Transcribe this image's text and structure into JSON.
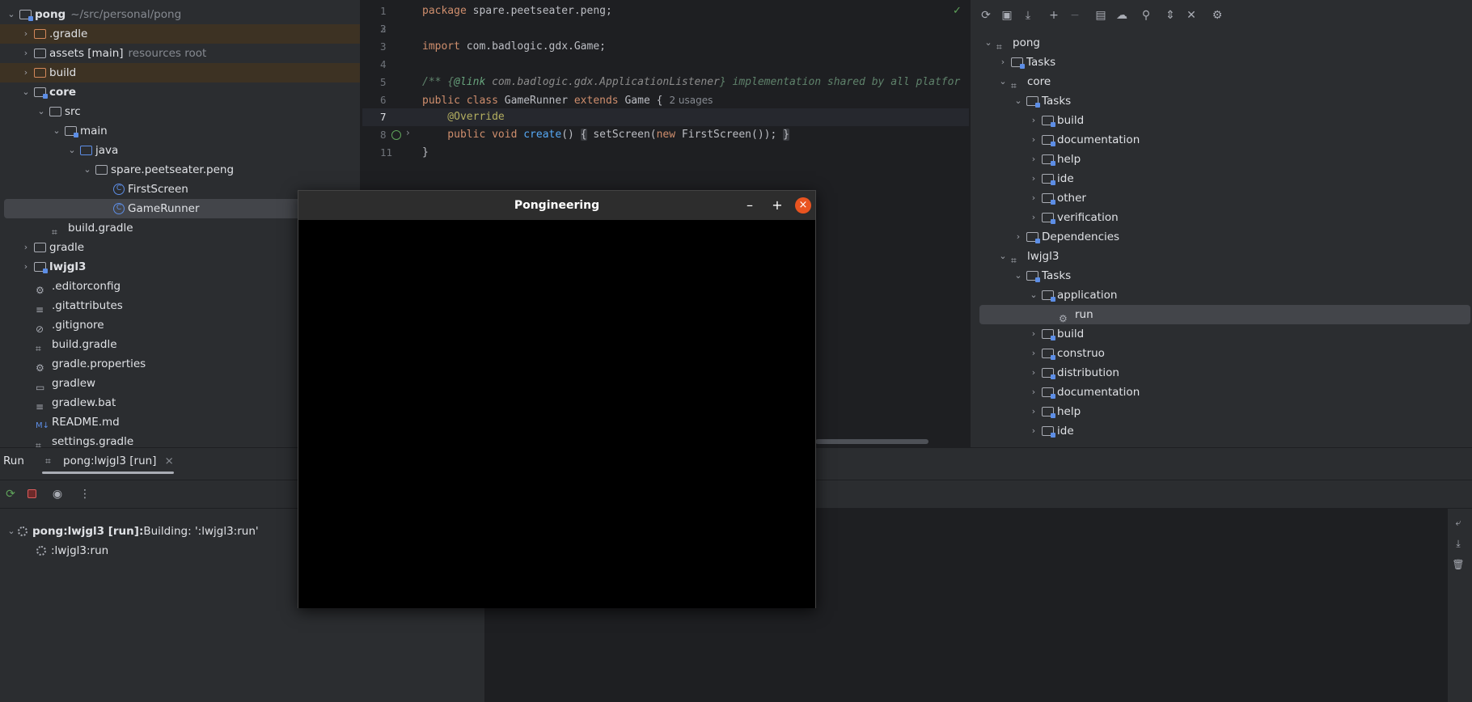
{
  "project": {
    "root_name": "pong",
    "root_path": "~/src/personal/pong",
    "items": [
      {
        "label": ".gradle"
      },
      {
        "label": "assets [main]",
        "suffix": "resources root"
      },
      {
        "label": "build"
      },
      {
        "label": "core"
      },
      {
        "label": "src"
      },
      {
        "label": "main"
      },
      {
        "label": "java"
      },
      {
        "label": "spare.peetseater.peng"
      },
      {
        "label": "FirstScreen"
      },
      {
        "label": "GameRunner"
      },
      {
        "label": "build.gradle"
      },
      {
        "label": "gradle"
      },
      {
        "label": "lwjgl3"
      },
      {
        "label": ".editorconfig"
      },
      {
        "label": ".gitattributes"
      },
      {
        "label": ".gitignore"
      },
      {
        "label": "build.gradle"
      },
      {
        "label": "gradle.properties"
      },
      {
        "label": "gradlew"
      },
      {
        "label": "gradlew.bat"
      },
      {
        "label": "README.md"
      },
      {
        "label": "settings.gradle"
      }
    ]
  },
  "editor": {
    "line_numbers": [
      "1",
      "3",
      "4",
      "5",
      "6",
      "7",
      "8",
      "11"
    ],
    "lines": {
      "l1_kw": "package",
      "l1_rest": " spare.peetseater.peng;",
      "l3_kw": "import",
      "l3_rest": " com.badlogic.gdx.Game;",
      "l5_comment_a": "/** {",
      "l5_tag": "@link",
      "l5_ref": " com.badlogic.gdx.ApplicationListener",
      "l5_comment_b": "} implementation shared by all platfor",
      "l6_kw1": "public class",
      "l6_name": " GameRunner ",
      "l6_kw2": "extends",
      "l6_rest": " Game {",
      "l6_hint": "2 usages",
      "l7_ann": "    @Override",
      "l8_kw": "    public void",
      "l8_fn": " create",
      "l8_a": "() ",
      "l8_b": "{",
      "l8_c": " setScreen(",
      "l8_kw2": "new",
      "l8_d": " FirstScreen()); ",
      "l8_e": "}",
      "l11": "}"
    }
  },
  "gradle": {
    "items": [
      {
        "label": "pong"
      },
      {
        "label": "Tasks"
      },
      {
        "label": "core"
      },
      {
        "label": "Tasks"
      },
      {
        "label": "build"
      },
      {
        "label": "documentation"
      },
      {
        "label": "help"
      },
      {
        "label": "ide"
      },
      {
        "label": "other"
      },
      {
        "label": "verification"
      },
      {
        "label": "Dependencies"
      },
      {
        "label": "lwjgl3"
      },
      {
        "label": "Tasks"
      },
      {
        "label": "application"
      },
      {
        "label": "run"
      },
      {
        "label": "build"
      },
      {
        "label": "construo"
      },
      {
        "label": "distribution"
      },
      {
        "label": "documentation"
      },
      {
        "label": "help"
      },
      {
        "label": "ide"
      }
    ]
  },
  "bottom": {
    "run_label": "Run",
    "tab_label": "pong:lwjgl3 [run]",
    "tab_close": "×",
    "build_title": "pong:lwjgl3 [run]:",
    "build_status": " Building: ':lwjgl3:run'",
    "sub_task": ":lwjgl3:run"
  },
  "game_window": {
    "title": "Pongineering",
    "minimize": "–",
    "maximize": "+",
    "close": "×"
  }
}
